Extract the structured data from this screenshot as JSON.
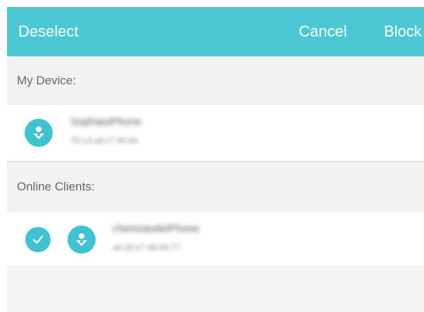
{
  "toolbar": {
    "deselect_label": "Deselect",
    "cancel_label": "Cancel",
    "block_label": "Block"
  },
  "sections": {
    "my_device": "My Device:",
    "online_clients": "Online Clients:"
  },
  "my_device": {
    "name": "SophiasiPhone",
    "mac": "70:14:a6:c7:40:84"
  },
  "online_clients": [
    {
      "name": "chenxiaodeiPhone",
      "mac": "a4:20:e7:db:84:77",
      "selected": true
    }
  ],
  "colors": {
    "accent": "#4cc8d4",
    "icon": "#3fc2d1"
  }
}
